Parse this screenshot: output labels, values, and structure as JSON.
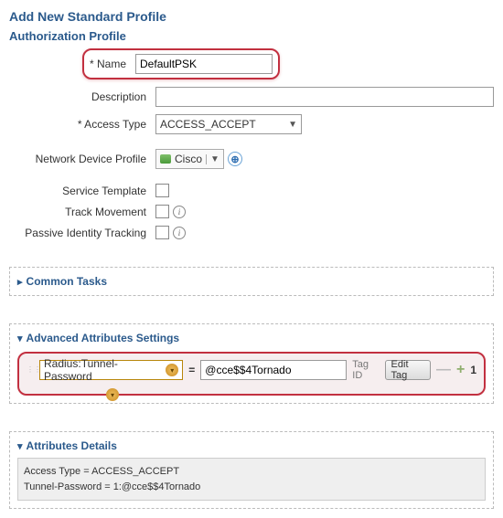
{
  "page_title": "Add New Standard Profile",
  "section_title": "Authorization Profile",
  "labels": {
    "name": "* Name",
    "description": "Description",
    "access_type": "* Access Type",
    "ndp": "Network Device Profile",
    "service_template": "Service Template",
    "track_movement": "Track Movement",
    "passive_identity": "Passive Identity Tracking"
  },
  "values": {
    "name": "DefaultPSK",
    "description": "",
    "access_type_selected": "ACCESS_ACCEPT",
    "ndp_selected": "Cisco"
  },
  "panels": {
    "common": "Common Tasks",
    "advanced": "Advanced Attributes Settings",
    "details": "Attributes Details"
  },
  "advanced_attr": {
    "attribute": "Radius:Tunnel-Password",
    "value": "@cce$$4Tornado",
    "tagid_label": "Tag ID",
    "edit_tag_btn": "Edit Tag",
    "row_num": "1"
  },
  "details_text": "Access Type = ACCESS_ACCEPT\nTunnel-Password = 1:@cce$$4Tornado"
}
